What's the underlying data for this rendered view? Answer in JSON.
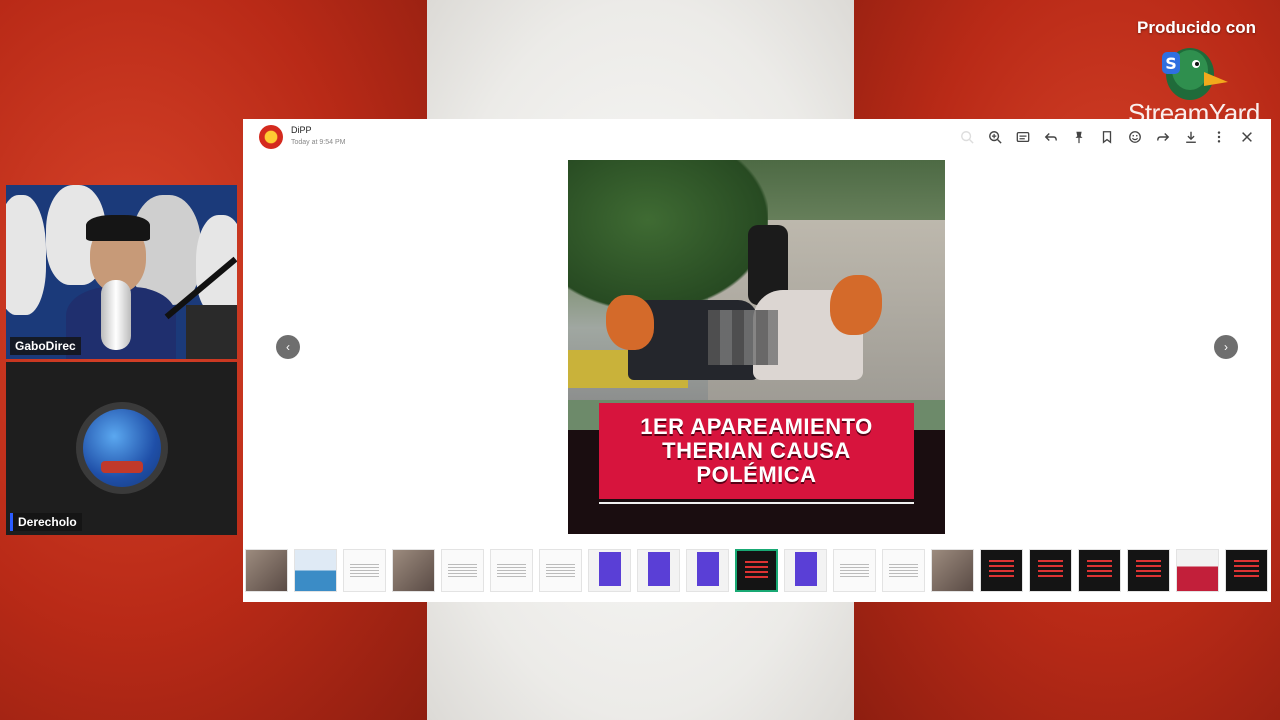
{
  "watermark": {
    "produced_with": "Producido con",
    "brand": "StreamYard"
  },
  "participants": [
    {
      "name": "GaboDirec"
    },
    {
      "name": "Derecholo"
    }
  ],
  "viewer": {
    "sender_name": "DiPP",
    "timestamp": "Today at 9:54 PM",
    "toolbar": {
      "zoom_out": "zoom-out",
      "zoom_in": "zoom-in",
      "caption": "caption",
      "reply": "reply",
      "pin": "pin",
      "bookmark": "bookmark",
      "react": "react",
      "forward": "forward",
      "download": "download",
      "more": "more",
      "close": "close"
    },
    "post_headline": "1ER APAREAMIENTO\nTHERIAN CAUSA\nPOLÉMICA",
    "thumbnails": [
      "photo",
      "sea",
      "doc",
      "photo",
      "doc",
      "doc",
      "doc",
      "blue",
      "blue",
      "blue",
      "active",
      "blue",
      "doc",
      "doc",
      "photo",
      "dark",
      "dark",
      "dark",
      "dark",
      "red",
      "dark"
    ]
  },
  "colors": {
    "flag_red": "#c8321f",
    "flag_white": "#f2f1ee",
    "headline_bg": "#d7143d",
    "active_thumb_border": "#19a974"
  }
}
